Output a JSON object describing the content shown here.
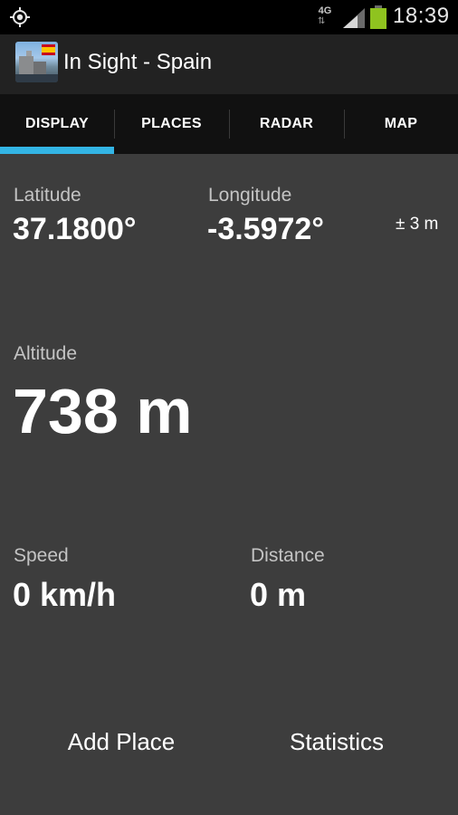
{
  "status_bar": {
    "network_type": "4G",
    "network_arrows": "⇅",
    "time": "18:39",
    "icons": [
      "gps-icon",
      "signal-icon",
      "battery-icon"
    ]
  },
  "action_bar": {
    "title": "In Sight - Spain",
    "app_icon": "app-icon-spain"
  },
  "tabs": [
    {
      "label": "DISPLAY",
      "selected": true
    },
    {
      "label": "PLACES",
      "selected": false
    },
    {
      "label": "RADAR",
      "selected": false
    },
    {
      "label": "MAP",
      "selected": false
    }
  ],
  "position": {
    "latitude_label": "Latitude",
    "latitude_value": "37.1800°",
    "longitude_label": "Longitude",
    "longitude_value": "-3.5972°",
    "accuracy": "± 3 m"
  },
  "altitude": {
    "label": "Altitude",
    "value": "738 m"
  },
  "motion": {
    "speed_label": "Speed",
    "speed_value": "0 km/h",
    "distance_label": "Distance",
    "distance_value": "0 m"
  },
  "buttons": {
    "add_place": "Add Place",
    "statistics": "Statistics"
  },
  "colors": {
    "accent": "#33b5e5",
    "background": "#3d3d3d",
    "action_bar": "#222222",
    "tab_bar": "#111111",
    "battery": "#8fc31f"
  }
}
